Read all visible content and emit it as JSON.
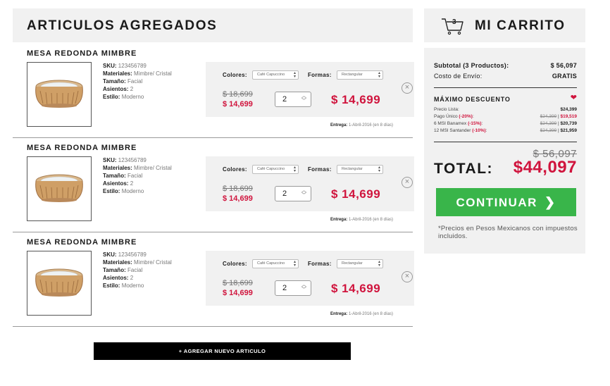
{
  "left_header": {
    "title": "ARTICULOS AGREGADOS"
  },
  "right_header": {
    "title": "MI CARRITO",
    "cart_count": "3",
    "cart_icon": "cart-icon"
  },
  "items": [
    {
      "name": "MESA REDONDA MIMBRE",
      "sku_label": "SKU:",
      "sku": "123456789",
      "materiales_label": "Materiales:",
      "materiales": "Mimbre/ Cristal",
      "tamano_label": "Tamaño:",
      "tamano": "Facial",
      "asientos_label": "Asientos:",
      "asientos": "2",
      "estilo_label": "Estilo:",
      "estilo": "Moderno",
      "colores_label": "Colores:",
      "color_value": "Café Capuccino",
      "formas_label": "Formas:",
      "forma_value": "Rectangular",
      "old_price": "$ 18,699",
      "price": "$ 14,699",
      "quantity": "2",
      "total": "$ 14,699",
      "delivery_label": "Entrega:",
      "delivery": "1-Abril-2016 (en 8 días)"
    },
    {
      "name": "MESA REDONDA MIMBRE",
      "sku_label": "SKU:",
      "sku": "123456789",
      "materiales_label": "Materiales:",
      "materiales": "Mimbre/ Cristal",
      "tamano_label": "Tamaño:",
      "tamano": "Facial",
      "asientos_label": "Asientos:",
      "asientos": "2",
      "estilo_label": "Estilo:",
      "estilo": "Moderno",
      "colores_label": "Colores:",
      "color_value": "Café Capuccino",
      "formas_label": "Formas:",
      "forma_value": "Rectangular",
      "old_price": "$ 18,699",
      "price": "$ 14,699",
      "quantity": "2",
      "total": "$ 14,699",
      "delivery_label": "Entrega:",
      "delivery": "1-Abril-2016 (en 8 días)"
    },
    {
      "name": "MESA REDONDA MIMBRE",
      "sku_label": "SKU:",
      "sku": "123456789",
      "materiales_label": "Materiales:",
      "materiales": "Mimbre/ Cristal",
      "tamano_label": "Tamaño:",
      "tamano": "Facial",
      "asientos_label": "Asientos:",
      "asientos": "2",
      "estilo_label": "Estilo:",
      "estilo": "Moderno",
      "colores_label": "Colores:",
      "color_value": "Café Capuccino",
      "formas_label": "Formas:",
      "forma_value": "Rectangular",
      "old_price": "$ 18,699",
      "price": "$ 14,699",
      "quantity": "2",
      "total": "$ 14,699",
      "delivery_label": "Entrega:",
      "delivery": "1-Abril-2016 (en 8 días)"
    }
  ],
  "add_button": {
    "label": "+ AGREGAR NUEVO ARTICULO"
  },
  "summary": {
    "subtotal_label": "Subtotal (3 Productos):",
    "subtotal": "$ 56,097",
    "shipping_label": "Costo de Envío:",
    "shipping": "GRATIS",
    "discount_title": "MÁXIMO DESCUENTO",
    "list_price_label": "Precio Lista:",
    "list_price": "$24,399",
    "d1_label": "Pago Único",
    "d1_pct": "(-20%)",
    "d1_old": "$24,399",
    "d1_new": "$19,519",
    "d2_label": "6 MSI Banamex",
    "d2_pct": "(-15%)",
    "d2_old": "$24,399",
    "d2_new": "$20,739",
    "d3_label": "12 MSI Santander",
    "d3_pct": "(-10%)",
    "d3_old": "$24,399",
    "d3_new": "$21,959",
    "old_total": "$ 56,097",
    "total_label": "TOTAL:",
    "total": "$44,097",
    "continue_label": "CONTINUAR",
    "note": "*Precios en Pesos Mexicanos con impuestos incluidos."
  },
  "colors": {
    "accent_red": "#d0143d",
    "continue_green": "#39b54a",
    "panel_gray": "#f1f1f1"
  }
}
